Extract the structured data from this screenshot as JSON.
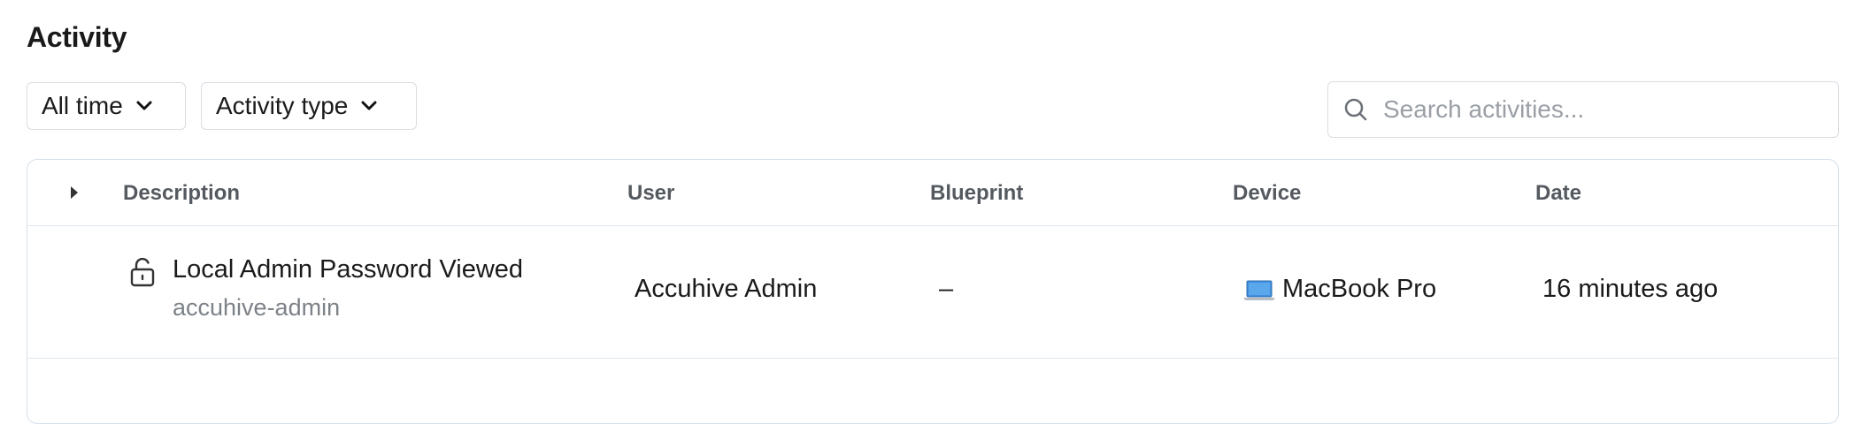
{
  "page": {
    "title": "Activity"
  },
  "filters": {
    "time": {
      "label": "All time"
    },
    "type": {
      "label": "Activity type"
    }
  },
  "search": {
    "placeholder": "Search activities...",
    "value": ""
  },
  "table": {
    "columns": [
      "Description",
      "User",
      "Blueprint",
      "Device",
      "Date"
    ],
    "rows": [
      {
        "icon": "unlock-icon",
        "description": "Local Admin Password Viewed",
        "subtitle": "accuhive-admin",
        "user": "Accuhive Admin",
        "blueprint": "–",
        "device_icon": "laptop-icon",
        "device": "MacBook Pro",
        "date": "16 minutes ago"
      }
    ]
  },
  "colors": {
    "border": "#d7e1ea",
    "header_text": "#555a60",
    "muted_text": "#7d8288",
    "placeholder": "#9a9fa6",
    "device_icon": "#4a90d9"
  }
}
